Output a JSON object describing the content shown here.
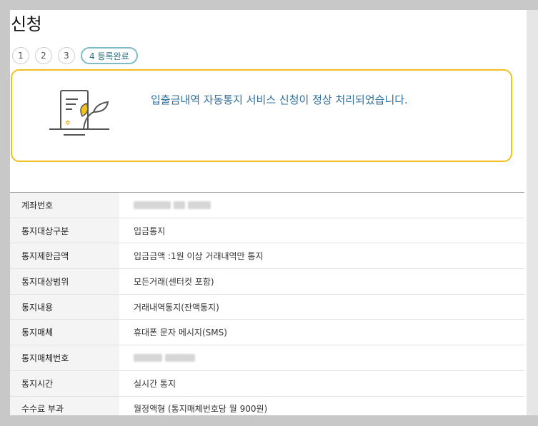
{
  "page": {
    "title": "신청"
  },
  "steps": [
    {
      "label": "1"
    },
    {
      "label": "2"
    },
    {
      "label": "3"
    },
    {
      "label": "4 등록완료"
    }
  ],
  "result": {
    "message": "입출금내역 자동통지 서비스 신청이 정상 처리되었습니다.",
    "icon": "document-plant-icon",
    "accent_color": "#f2bf1e",
    "message_color": "#2f6f9e"
  },
  "details": [
    {
      "label": "계좌번호",
      "value": ""
    },
    {
      "label": "통지대상구분",
      "value": "입금통지"
    },
    {
      "label": "통지제한금액",
      "value": "입금금액 :1원 이상 거래내역만 통지"
    },
    {
      "label": "통지대상범위",
      "value": "모든거래(센터컷 포함)"
    },
    {
      "label": "통지내용",
      "value": "거래내역통지(잔액통지)"
    },
    {
      "label": "통지매체",
      "value": "휴대폰 문자 메시지(SMS)"
    },
    {
      "label": "통지매체번호",
      "value": ""
    },
    {
      "label": "통지시간",
      "value": "실시간 통지"
    },
    {
      "label": "수수료 부과",
      "value": "월정액형 (통지매체번호당 월 900원)"
    }
  ]
}
